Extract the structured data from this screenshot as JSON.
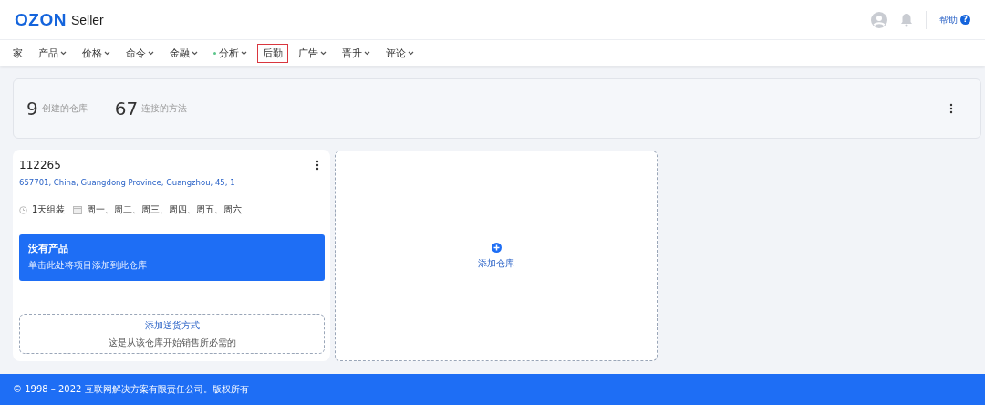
{
  "header": {
    "logo": "OZON",
    "logo_suffix": "Seller",
    "help": "帮助",
    "help_badge": "?"
  },
  "nav": [
    {
      "label": "家",
      "caret": false,
      "dot": false,
      "selected": false
    },
    {
      "label": "产品",
      "caret": true,
      "dot": false,
      "selected": false
    },
    {
      "label": "价格",
      "caret": true,
      "dot": false,
      "selected": false
    },
    {
      "label": "命令",
      "caret": true,
      "dot": false,
      "selected": false
    },
    {
      "label": "金融",
      "caret": true,
      "dot": false,
      "selected": false
    },
    {
      "label": "分析",
      "caret": true,
      "dot": true,
      "selected": false
    },
    {
      "label": "后勤",
      "caret": false,
      "dot": false,
      "selected": true
    },
    {
      "label": "广告",
      "caret": true,
      "dot": false,
      "selected": false
    },
    {
      "label": "晋升",
      "caret": true,
      "dot": false,
      "selected": false
    },
    {
      "label": "评论",
      "caret": true,
      "dot": false,
      "selected": false
    }
  ],
  "stats": [
    {
      "value": "9",
      "label": "创建的仓库"
    },
    {
      "value": "67",
      "label": "连接的方法"
    }
  ],
  "warehouse": {
    "id": "112265",
    "address": "657701, China, Guangdong Province, Guangzhou, 45, 1",
    "assembly": "1天组装",
    "days": "周一、周二、周三、周四、周五、周六",
    "banner_title": "没有产品",
    "banner_text": "单击此处将项目添加到此仓库",
    "delivery_title": "添加送货方式",
    "delivery_text": "这是从该仓库开始销售所必需的"
  },
  "add_warehouse": "添加仓库",
  "footer": "© 1998 – 2022 互联网解决方案有限责任公司。版权所有"
}
